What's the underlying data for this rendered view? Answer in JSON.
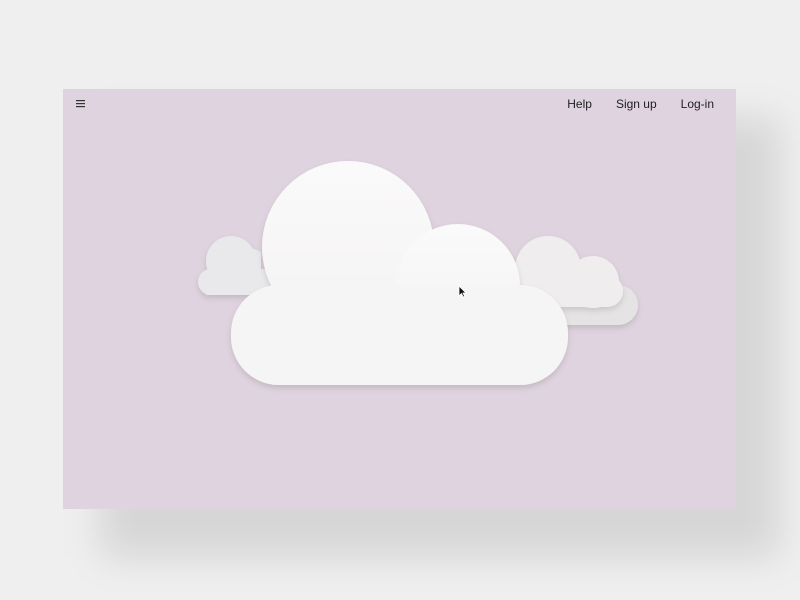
{
  "window": {
    "background_color": "#ded3de"
  },
  "header": {
    "menu_icon": "hamburger-menu-icon",
    "nav_links": [
      {
        "label": "Help"
      },
      {
        "label": "Sign up"
      },
      {
        "label": "Log-in"
      }
    ]
  },
  "scene": {
    "icon_names": [
      "cloud-back-left",
      "cloud-back-right",
      "cloud-front",
      "mouse-pointer-icon"
    ],
    "colors": {
      "cloud_front": "#f6f5f5",
      "cloud_back_left": "#e9e8ea",
      "cloud_back_right": "#efedee",
      "cloud_back_right_rear": "#e5e3e4"
    }
  }
}
